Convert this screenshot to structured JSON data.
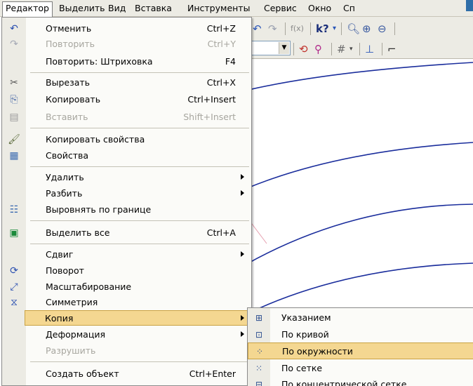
{
  "menubar": {
    "items": [
      "Редактор",
      "Выделить",
      "Вид",
      "Вставка",
      "Инструменты",
      "Сервис",
      "Окно",
      "Сп"
    ]
  },
  "toolbar": {
    "fx_label": "f(x)",
    "help_glyph": "k?"
  },
  "edit_menu": {
    "items": [
      {
        "label": "Отменить",
        "shortcut": "Ctrl+Z",
        "icon": "undo-icon"
      },
      {
        "label": "Повторить",
        "shortcut": "Ctrl+Y",
        "icon": "redo-icon"
      },
      {
        "label": "Повторить: Штриховка",
        "shortcut": "F4"
      },
      {
        "label": "Вырезать",
        "shortcut": "Ctrl+X",
        "icon": "scissors-icon"
      },
      {
        "label": "Копировать",
        "shortcut": "Ctrl+Insert",
        "icon": "copy-icon"
      },
      {
        "label": "Вставить",
        "shortcut": "Shift+Insert",
        "icon": "paste-icon"
      },
      {
        "label": "Копировать свойства",
        "icon": "brush-icon"
      },
      {
        "label": "Свойства",
        "icon": "properties-icon"
      },
      {
        "label": "Удалить"
      },
      {
        "label": "Разбить"
      },
      {
        "label": "Выровнять по границе",
        "icon": "align-icon"
      },
      {
        "label": "Выделить все",
        "shortcut": "Ctrl+A",
        "icon": "select-all-icon"
      },
      {
        "label": "Сдвиг"
      },
      {
        "label": "Поворот",
        "icon": "rotate-icon"
      },
      {
        "label": "Масштабирование",
        "icon": "scale-icon"
      },
      {
        "label": "Симметрия",
        "icon": "symmetry-icon"
      },
      {
        "label": "Копия"
      },
      {
        "label": "Деформация"
      },
      {
        "label": "Разрушить"
      },
      {
        "label": "Создать объект",
        "shortcut": "Ctrl+Enter"
      }
    ]
  },
  "copy_submenu": {
    "items": [
      {
        "label": "Указанием",
        "icon": "copy-point-icon"
      },
      {
        "label": "По кривой",
        "icon": "copy-curve-icon"
      },
      {
        "label": "По окружности",
        "icon": "copy-circle-icon"
      },
      {
        "label": "По сетке",
        "icon": "copy-grid-icon"
      },
      {
        "label": "По концентрической сетке",
        "icon": "copy-concentric-icon"
      }
    ]
  },
  "colors": {
    "highlight": "#f4d791",
    "curve": "#1a2d9c",
    "gutter": "#ecebe4"
  }
}
